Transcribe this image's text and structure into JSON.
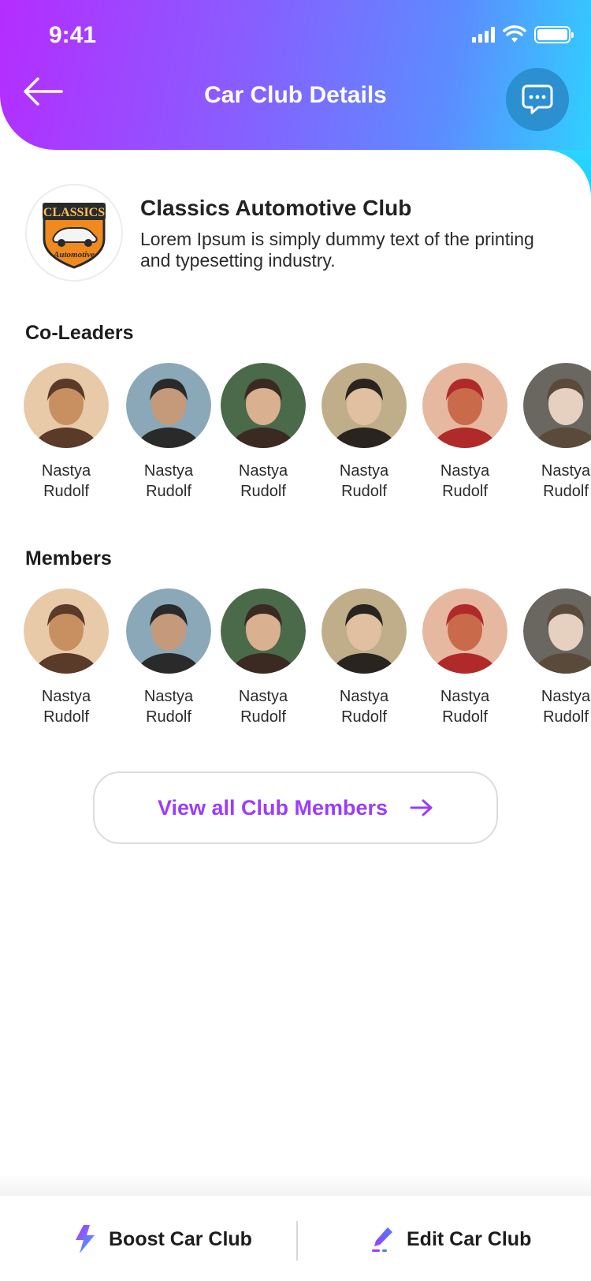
{
  "status_bar": {
    "time": "9:41"
  },
  "header": {
    "title": "Car Club Details"
  },
  "club": {
    "logo_text_top": "CLASSICS",
    "logo_text_bottom": "Automotive",
    "name": "Classics Automotive Club",
    "description": "Lorem Ipsum is simply dummy text of the printing and typesetting industry."
  },
  "co_leaders": {
    "title": "Co-Leaders",
    "people": [
      {
        "first": "Nastya",
        "last": "Rudolf"
      },
      {
        "first": "Nastya",
        "last": "Rudolf"
      },
      {
        "first": "Nastya",
        "last": "Rudolf"
      },
      {
        "first": "Nastya",
        "last": "Rudolf"
      },
      {
        "first": "Nastya",
        "last": "Rudolf"
      },
      {
        "first": "Nastya",
        "last": "Rudolf"
      }
    ]
  },
  "members": {
    "title": "Members",
    "people": [
      {
        "first": "Nastya",
        "last": "Rudolf"
      },
      {
        "first": "Nastya",
        "last": "Rudolf"
      },
      {
        "first": "Nastya",
        "last": "Rudolf"
      },
      {
        "first": "Nastya",
        "last": "Rudolf"
      },
      {
        "first": "Nastya",
        "last": "Rudolf"
      },
      {
        "first": "Nastya",
        "last": "Rudolf"
      }
    ]
  },
  "view_all": {
    "label": "View all Club Members"
  },
  "bottom_bar": {
    "boost_label": "Boost Car Club",
    "edit_label": "Edit Car Club"
  },
  "colors": {
    "accent": "#9b3cff",
    "header_gradient_start": "#b52cff",
    "header_gradient_end": "#2fd0ff",
    "chat_button": "#2b8fd0"
  }
}
